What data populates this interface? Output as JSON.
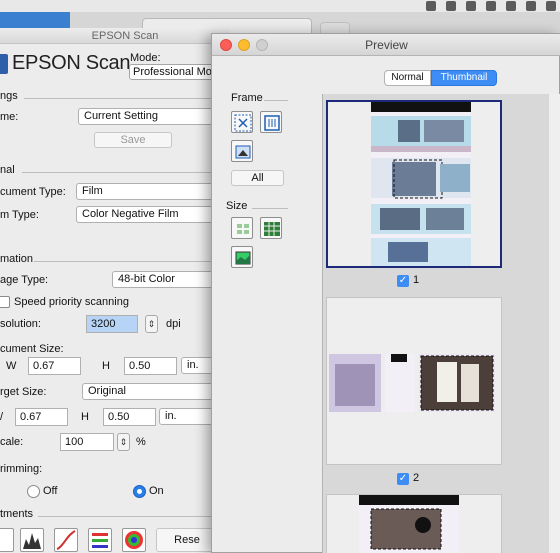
{
  "epson_window": {
    "title": "EPSON Scan",
    "logo_text": "EPSON Scan",
    "mode_label": "Mode:",
    "mode_value": "Professional Mo",
    "settings_section": "ngs",
    "name_label": "me:",
    "name_value": "Current Setting",
    "save_label": "Save",
    "original_section": "nal",
    "document_type_label": "cument Type:",
    "document_type_value": "Film",
    "film_type_label": "m Type:",
    "film_type_value": "Color Negative Film",
    "destination_section": "mation",
    "image_type_label": "age Type:",
    "image_type_value": "48-bit Color",
    "speed_priority_label": "Speed priority scanning",
    "resolution_label": "solution:",
    "resolution_value": "3200",
    "resolution_unit": "dpi",
    "document_size_label": "cument Size:",
    "doc_w_label": "W",
    "doc_w_value": "0.67",
    "doc_h_label": "H",
    "doc_h_value": "0.50",
    "doc_unit": "in.",
    "target_size_label": "rget Size:",
    "target_size_value": "Original",
    "target_w_label": "/",
    "target_w_value": "0.67",
    "target_h_label": "H",
    "target_h_value": "0.50",
    "target_unit": "in.",
    "scale_label": "cale:",
    "scale_value": "100",
    "scale_unit": "%",
    "trimming_label": "rimming:",
    "trimming_off": "Off",
    "trimming_on": "On",
    "adjustments_section": "tments",
    "reset_label": "Rese"
  },
  "preview_window": {
    "title": "Preview",
    "tab_normal": "Normal",
    "tab_thumbnail": "Thumbnail",
    "frame_label": "Frame",
    "all_label": "All",
    "size_label": "Size",
    "frames": [
      {
        "number": "1",
        "checked": true,
        "selected": true
      },
      {
        "number": "2",
        "checked": true,
        "selected": false
      }
    ]
  },
  "colors": {
    "accent_blue": "#3e8df5",
    "selected_frame": "#1d2a7a",
    "window_bg": "#ececec"
  }
}
